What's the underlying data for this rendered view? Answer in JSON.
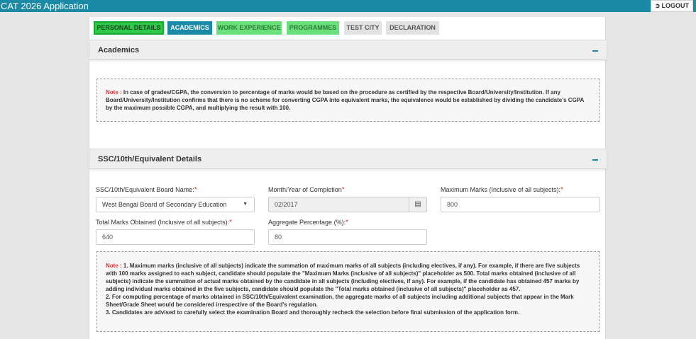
{
  "app": {
    "title": "CAT 2026 Application",
    "logout_label": "LOGOUT"
  },
  "tabs": [
    {
      "label": "PERSONAL DETAILS"
    },
    {
      "label": "ACADEMICS"
    },
    {
      "label": "WORK EXPERIENCE"
    },
    {
      "label": "PROGRAMMES"
    },
    {
      "label": "TEST CITY"
    },
    {
      "label": "DECLARATION"
    }
  ],
  "academics": {
    "title": "Academics",
    "note_label": "Note :",
    "note_text": "In case of grades/CGPA, the conversion to percentage of marks would be based on the procedure as certified by the respective Board/University/Institution. If any Board/University/Institution confirms that there is no scheme for converting CGPA into equivalent marks, the equivalence would be established by dividing the candidate's CGPA by the maximum possible CGPA, and multiplying the result with 100."
  },
  "ssc": {
    "title": "SSC/10th/Equivalent Details",
    "board_label": "SSC/10th/Equivalent Board Name:",
    "board_value": "West Bengal Board of Secondary Education",
    "completion_label": "Month/Year of Completion",
    "completion_value": "02/2017",
    "max_marks_label": "Maximum Marks (Inclusive of all subjects):",
    "max_marks_value": "800",
    "total_marks_label": "Total Marks Obtained (Inclusive of all subjects):",
    "total_marks_value": "640",
    "aggregate_label": "Aggregate Percentage (%):",
    "aggregate_value": "80",
    "required_mark": "*",
    "note_label": "Note :",
    "note_line1": "1. Maximum marks (inclusive of all subjects) indicate the summation of maximum marks of all subjects (including electives, if any). For example, if there are five subjects with 100 marks assigned to each subject, candidate should populate the \"Maximum Marks (inclusive of all subjects)\" placeholder as 500. Total marks obtained (inclusive of all subjects) indicate the summation of actual marks obtained by the candidate in all subjects (including electives, if any). For example, if the candidate has obtained 457 marks by adding individual marks obtained in the five subjects, candidate should populate the \"Total marks obtained (inclusive of all subjects)\" placeholder as 457.",
    "note_line2": "2. For computing percentage of marks obtained in SSC/10th/Equivalent examination, the aggregate marks of all subjects including additional subjects that appear in the Mark Sheet/Grade Sheet would be considered irrespective of the Board's regulation.",
    "note_line3": "3. Candidates are advised to carefully select the examination Board and thoroughly recheck the selection before final submission of the application form."
  },
  "icons": {
    "logout": "logout-icon",
    "dropdown": "caret-down-icon",
    "calendar": "calendar-icon",
    "collapse": "minus-icon"
  },
  "colors": {
    "brand": "#1b8aa6",
    "tab_done": "#2ec94a",
    "required": "#e53030"
  }
}
